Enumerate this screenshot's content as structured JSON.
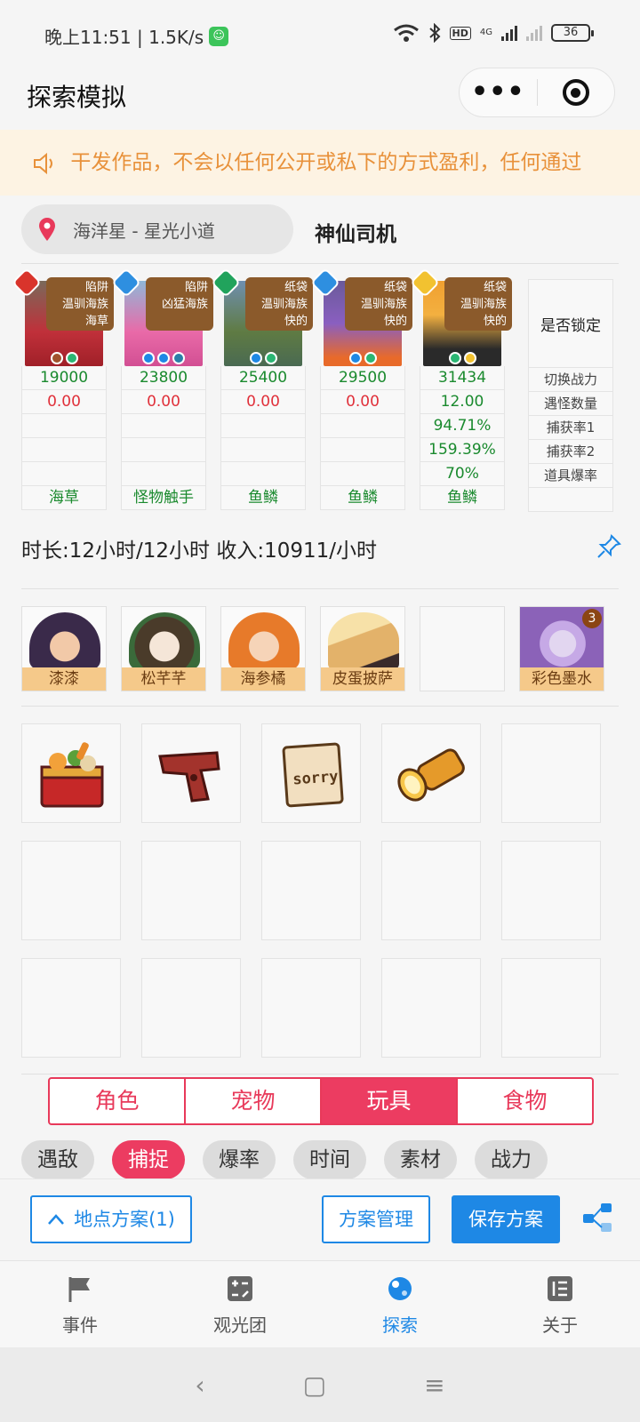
{
  "status_bar": {
    "time_speed": "晚上11:51 | 1.5K/s",
    "hd": "HD",
    "net": "4G",
    "battery": "36"
  },
  "title_bar": {
    "title": "探索模拟"
  },
  "notice": {
    "text": "干发作品，不会以任何公开或私下的方式盈利，任何通过"
  },
  "location": {
    "place": "海洋星 - 星光小道",
    "driver": "神仙司机"
  },
  "pets": [
    {
      "tag": "陷阱",
      "line2": "温驯海族",
      "line3": "海草",
      "power": "19000",
      "encounter": "0.00",
      "catch1": "",
      "catch2": "",
      "drop": "",
      "material": "海草",
      "element": "fire"
    },
    {
      "tag": "陷阱",
      "line2": "凶猛海族",
      "line3": "",
      "power": "23800",
      "encounter": "0.00",
      "catch1": "",
      "catch2": "",
      "drop": "",
      "material": "怪物触手",
      "element": "water"
    },
    {
      "tag": "纸袋",
      "line2": "温驯海族",
      "line3": "快的",
      "power": "25400",
      "encounter": "0.00",
      "catch1": "",
      "catch2": "",
      "drop": "",
      "material": "鱼鳞",
      "element": "grass"
    },
    {
      "tag": "纸袋",
      "line2": "温驯海族",
      "line3": "快的",
      "power": "29500",
      "encounter": "0.00",
      "catch1": "",
      "catch2": "",
      "drop": "",
      "material": "鱼鳞",
      "element": "water"
    },
    {
      "tag": "纸袋",
      "line2": "温驯海族",
      "line3": "快的",
      "power": "31434",
      "encounter": "12.00",
      "catch1": "94.71%",
      "catch2": "159.39%",
      "drop": "70%",
      "material": "鱼鳞",
      "element": "light"
    }
  ],
  "row_labels": {
    "lock": "是否锁定",
    "power": "切换战力",
    "encounter": "遇怪数量",
    "catch1": "捕获率1",
    "catch2": "捕获率2",
    "drop": "道具爆率"
  },
  "summary": {
    "text": "时长:12小时/12小时 收入:10911/小时"
  },
  "characters": [
    {
      "name": "漆漆"
    },
    {
      "name": "松芊芊"
    },
    {
      "name": "海参橘"
    },
    {
      "name": "皮蛋披萨"
    },
    {
      "name": ""
    },
    {
      "name": "彩色墨水",
      "count": "3"
    }
  ],
  "items": [
    {
      "icon": "food-box-icon"
    },
    {
      "icon": "pistol-icon"
    },
    {
      "icon": "sorry-note-icon"
    },
    {
      "icon": "flashlight-icon"
    }
  ],
  "category_tabs": [
    "角色",
    "宠物",
    "玩具",
    "食物"
  ],
  "active_category": "玩具",
  "filter_chips": [
    "遇敌",
    "捕捉",
    "爆率",
    "时间",
    "素材",
    "战力"
  ],
  "active_chip": "捕捉",
  "actions": {
    "location_plan": "地点方案(1)",
    "manage": "方案管理",
    "save": "保存方案"
  },
  "tabbar": [
    {
      "label": "事件",
      "icon": "flag-icon"
    },
    {
      "label": "观光团",
      "icon": "calc-icon"
    },
    {
      "label": "探索",
      "icon": "planet-icon"
    },
    {
      "label": "关于",
      "icon": "list-icon"
    }
  ],
  "active_tab": "探索",
  "colors": {
    "accent_red": "#ec3c61",
    "accent_blue": "#1e88e5",
    "notice_text": "#e8913a"
  }
}
